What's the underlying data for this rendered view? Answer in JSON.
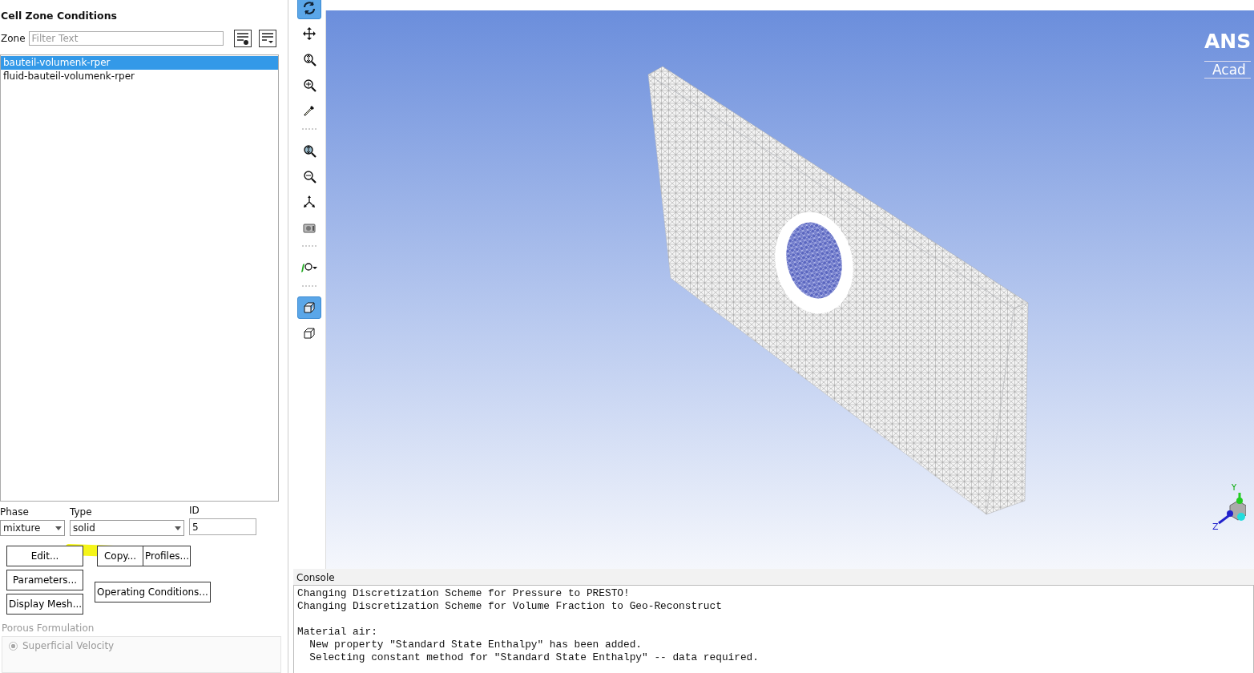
{
  "panel": {
    "title": "Cell Zone Conditions",
    "zone_label": "Zone",
    "filter_placeholder": "Filter Text"
  },
  "zones": [
    {
      "name": "bauteil-volumenk-rper",
      "selected": true
    },
    {
      "name": "fluid-bauteil-volumenk-rper",
      "selected": false
    }
  ],
  "phase": {
    "label": "Phase",
    "value": "mixture"
  },
  "type": {
    "label": "Type",
    "value": "solid"
  },
  "id": {
    "label": "ID",
    "value": "5"
  },
  "buttons": [
    "Edit...",
    "Copy...",
    "Profiles...",
    "Parameters...",
    "Operating Conditions...",
    "Display Mesh..."
  ],
  "porous": {
    "label": "Porous Formulation",
    "disabled": true,
    "options": [
      {
        "label": "Superficial Velocity",
        "selected": true
      }
    ]
  },
  "toolbar": [
    {
      "kind": "rotate",
      "selected": true
    },
    {
      "kind": "pan",
      "selected": false
    },
    {
      "kind": "zoom-fit",
      "selected": false
    },
    {
      "kind": "zoom-in",
      "selected": false
    },
    {
      "kind": "probe",
      "selected": false
    },
    {
      "kind": "separator"
    },
    {
      "kind": "zoom-box",
      "selected": false
    },
    {
      "kind": "zoom-out",
      "selected": false
    },
    {
      "kind": "axes",
      "selected": false
    },
    {
      "kind": "camera",
      "selected": false
    },
    {
      "kind": "separator"
    },
    {
      "kind": "view",
      "selected": false
    },
    {
      "kind": "separator"
    },
    {
      "kind": "cube",
      "selected": true
    },
    {
      "kind": "cube-outline",
      "selected": false
    }
  ],
  "viewport": {
    "logo": "ANS",
    "logo_sub": "Acad",
    "axes": [
      "Y",
      "Z"
    ]
  },
  "console": {
    "title": "Console",
    "blocks": [
      [
        "Changing Discretization Scheme for Pressure to PRESTO!",
        "Changing Discretization Scheme for Volume Fraction to Geo-Reconstruct"
      ],
      [
        "Material air:",
        "  New property \"Standard State Enthalpy\" has been added.",
        "  Selecting constant method for \"Standard State Enthalpy\" -- data required."
      ]
    ]
  }
}
